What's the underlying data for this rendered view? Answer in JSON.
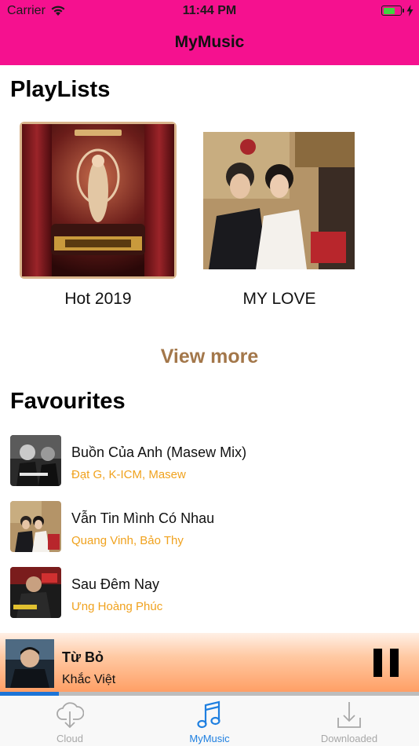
{
  "status_bar": {
    "carrier": "Carrier",
    "time": "11:44 PM"
  },
  "nav": {
    "title": "MyMusic"
  },
  "playlists": {
    "heading": "PlayLists",
    "items": [
      {
        "name": "Hot 2019"
      },
      {
        "name": "MY LOVE"
      }
    ],
    "view_more": "View more"
  },
  "favourites": {
    "heading": "Favourites",
    "items": [
      {
        "title": "Buồn Của Anh (Masew Mix)",
        "artist": "Đạt G, K-ICM, Masew"
      },
      {
        "title": "Vẫn Tin Mình Có Nhau",
        "artist": "Quang Vinh, Bảo Thy"
      },
      {
        "title": "Sau Đêm Nay",
        "artist": "Ưng Hoàng Phúc"
      }
    ]
  },
  "now_playing": {
    "title": "Từ Bỏ",
    "artist": "Khắc Việt",
    "progress": 0.14
  },
  "tabs": [
    {
      "label": "Cloud",
      "icon": "cloud-download-icon",
      "active": false
    },
    {
      "label": "MyMusic",
      "icon": "music-note-icon",
      "active": true
    },
    {
      "label": "Downloaded",
      "icon": "download-tray-icon",
      "active": false
    }
  ],
  "colors": {
    "header": "#f5118f",
    "accent": "#1e7fe0",
    "artist_text": "#f0a21e",
    "view_more": "#a3774a"
  }
}
